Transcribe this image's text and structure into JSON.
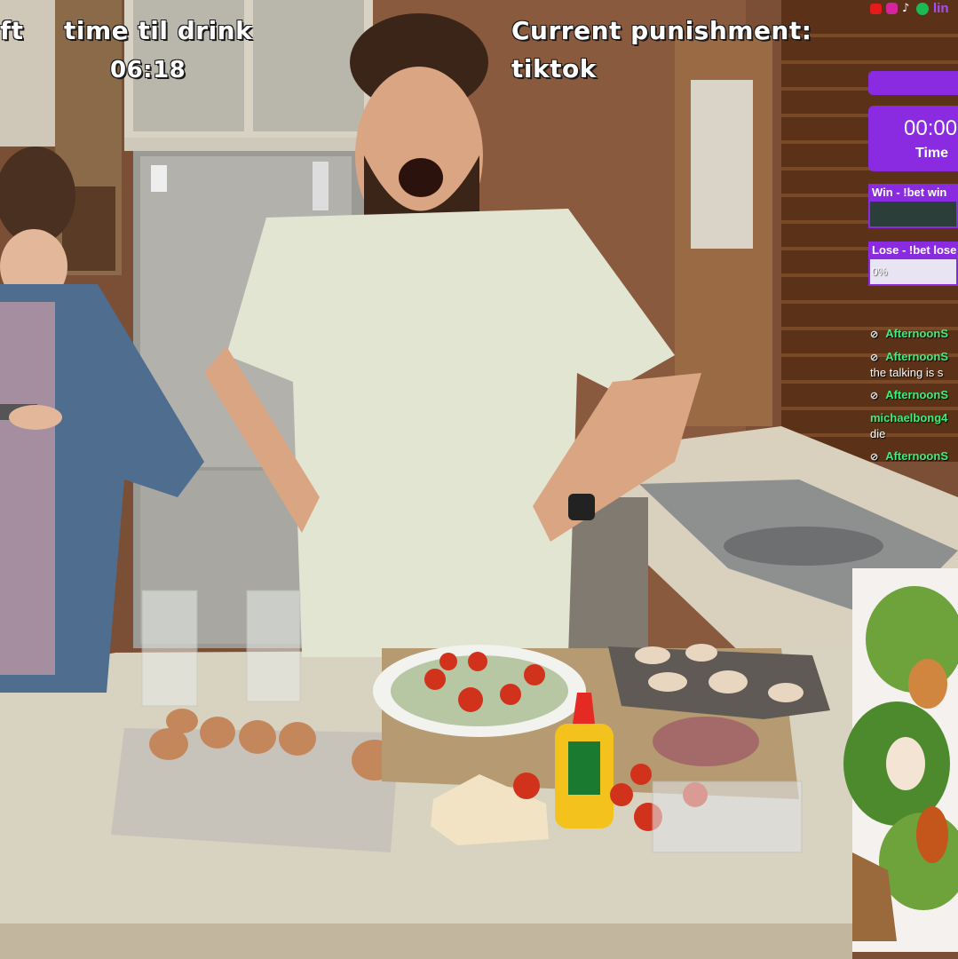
{
  "overlay": {
    "left_fragment": "ft",
    "drink_label": "time til drink",
    "drink_timer": "06:18",
    "punishment_label": "Current punishment:",
    "punishment_value": "tiktok"
  },
  "social_icons": [
    "youtube-icon",
    "instagram-icon",
    "tiktok-icon",
    "spotify-icon"
  ],
  "social_link_fragment": "lin",
  "timer_widget": {
    "time": "00:00",
    "label": "Time"
  },
  "bets": {
    "win_label": "Win - !bet win",
    "lose_label": "Lose - !bet lose",
    "lose_percent": "0%"
  },
  "chat": [
    {
      "user": "AfternoonS",
      "message": ""
    },
    {
      "user": "AfternoonS",
      "message": "the talking is s"
    },
    {
      "user": "AfternoonS",
      "message": ""
    },
    {
      "user": "michaelbong4",
      "message": "die"
    },
    {
      "user": "AfternoonS",
      "message": ""
    }
  ],
  "colors": {
    "accent": "#8a2be2",
    "chat_user": "#3cf07a",
    "wall": "#8b5a3c"
  }
}
